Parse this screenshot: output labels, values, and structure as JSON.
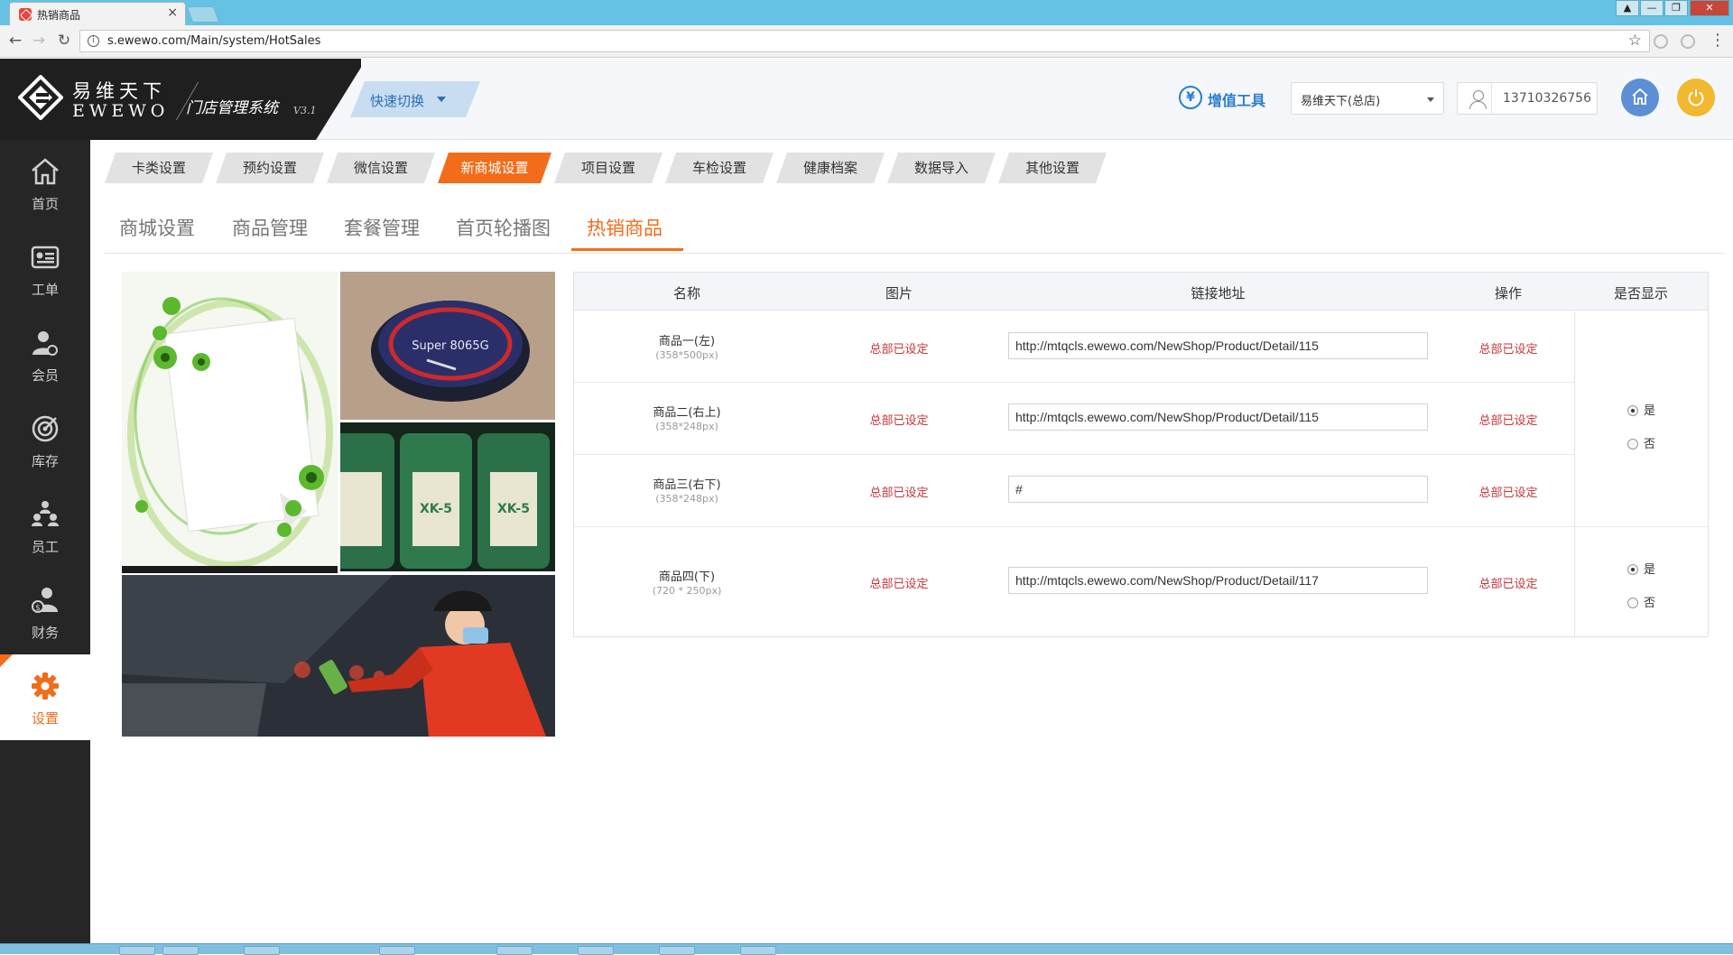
{
  "browser": {
    "tab_title": "热销商品",
    "tab_close": "×",
    "url": "s.ewewo.com/Main/system/HotSales",
    "back": "←",
    "forward": "→",
    "reload": "↻",
    "info": "i",
    "star": "☆",
    "menu": "⋮",
    "window_controls": [
      "▲",
      "—",
      "❐",
      "✕"
    ]
  },
  "header": {
    "logo_cn": "易维天下",
    "logo_en": "EWEWO",
    "system_name": "门店管理系统",
    "version": "V3.1",
    "quick_switch": "快速切换",
    "value_added_icon": "¥",
    "value_added": "增值工具",
    "store": "易维天下(总店)",
    "phone": "13710326756"
  },
  "sidebar": {
    "items": [
      {
        "label": "首页",
        "icon": "home-icon"
      },
      {
        "label": "工单",
        "icon": "work-order-icon"
      },
      {
        "label": "会员",
        "icon": "member-icon"
      },
      {
        "label": "库存",
        "icon": "inventory-icon"
      },
      {
        "label": "员工",
        "icon": "staff-icon"
      },
      {
        "label": "财务",
        "icon": "finance-icon"
      },
      {
        "label": "设置",
        "icon": "gear-icon"
      }
    ],
    "active_index": 6
  },
  "category_tabs": [
    "卡类设置",
    "预约设置",
    "微信设置",
    "新商城设置",
    "项目设置",
    "车检设置",
    "健康档案",
    "数据导入",
    "其他设置"
  ],
  "category_active": "新商城设置",
  "sub_tabs": [
    "商城设置",
    "商品管理",
    "套餐管理",
    "首页轮播图",
    "热销商品"
  ],
  "sub_active": "热销商品",
  "table": {
    "headers": {
      "name": "名称",
      "picture": "图片",
      "link": "链接地址",
      "operation": "操作",
      "visible": "是否显示"
    },
    "rows": [
      {
        "name": "商品一(左)",
        "size": "(358*500px)",
        "picture": "总部已设定",
        "link": "http://mtqcls.ewewo.com/NewShop/Product/Detail/115",
        "operation": "总部已设定"
      },
      {
        "name": "商品二(右上)",
        "size": "(358*248px)",
        "picture": "总部已设定",
        "link": "http://mtqcls.ewewo.com/NewShop/Product/Detail/115",
        "operation": "总部已设定"
      },
      {
        "name": "商品三(右下)",
        "size": "(358*248px)",
        "picture": "总部已设定",
        "link": "#",
        "operation": "总部已设定"
      },
      {
        "name": "商品四(下)",
        "size": "(720 * 250px)",
        "picture": "总部已设定",
        "link": "http://mtqcls.ewewo.com/NewShop/Product/Detail/117",
        "operation": "总部已设定"
      }
    ],
    "visibility_groups": [
      {
        "yes": "是",
        "no": "否",
        "selected": "是"
      },
      {
        "yes": "是",
        "no": "否",
        "selected": "是"
      }
    ]
  },
  "previews": {
    "tin_label": "Super 8065G",
    "bottle_label": "XK-5"
  }
}
